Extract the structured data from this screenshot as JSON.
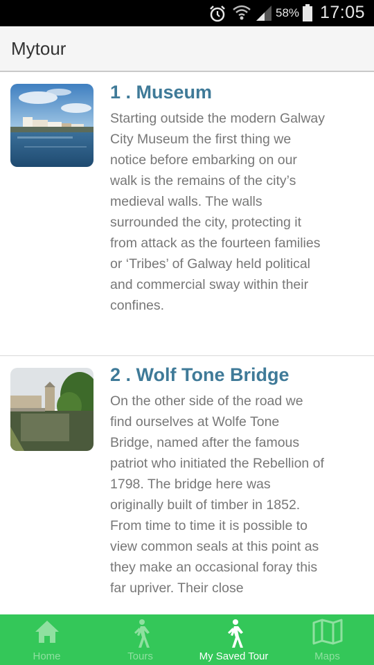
{
  "status_bar": {
    "battery_percent": "58%",
    "time": "17:05",
    "icons": [
      "alarm-icon",
      "wifi-icon",
      "signal-icon",
      "battery-icon"
    ]
  },
  "app_bar": {
    "title": "Mytour"
  },
  "stops": [
    {
      "title": "1 . Museum",
      "description": "Starting outside the modern Galway City Museum the first thing we notice before embarking on our walk is the remains of the city’s medieval walls. The walls surrounded the city, protecting it from attack as the fourteen families or ‘Tribes’ of Galway held political and commercial sway within their confines."
    },
    {
      "title": "2 . Wolf Tone Bridge",
      "description": "On the other side of the road we find ourselves at Wolfe Tone Bridge, named after the famous patriot who initiated the Rebellion of 1798. The bridge here was originally built of timber in 1852. From time to time it is possible to view common seals at this point as they make an occasional foray this far upriver. Their close"
    }
  ],
  "bottom_nav": {
    "items": [
      {
        "label": "Home",
        "icon": "home-icon",
        "active": false
      },
      {
        "label": "Tours",
        "icon": "walking-person-icon",
        "active": false
      },
      {
        "label": "My Saved Tour",
        "icon": "walking-person-icon",
        "active": true
      },
      {
        "label": "Maps",
        "icon": "map-icon",
        "active": false
      }
    ]
  },
  "colors": {
    "accent_green": "#34c759",
    "title_blue": "#3f7a98",
    "body_text": "#777777"
  }
}
